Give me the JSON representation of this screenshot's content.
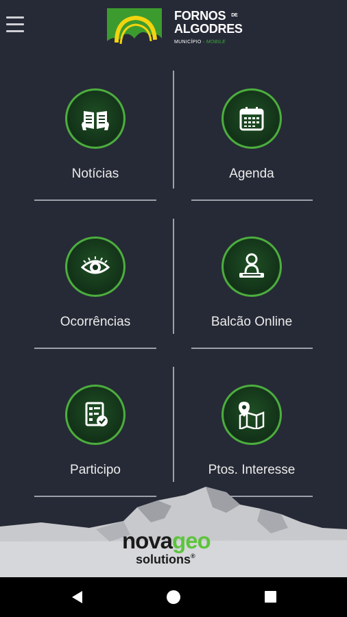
{
  "header": {
    "menu_icon": "hamburger-menu-icon",
    "logo": {
      "line1": "FORNOS",
      "de": "DE",
      "line2": "ALGODRES",
      "sub_municipio": "MUNICÍPIO · ",
      "sub_mobile": "MOBILE"
    }
  },
  "tiles": [
    {
      "label": "Notícias",
      "icon": "newspaper-icon"
    },
    {
      "label": "Agenda",
      "icon": "calendar-icon"
    },
    {
      "label": "Ocorrências",
      "icon": "eye-icon"
    },
    {
      "label": "Balcão Online",
      "icon": "service-desk-icon"
    },
    {
      "label": "Participo",
      "icon": "checklist-icon"
    },
    {
      "label": "Ptos. Interesse",
      "icon": "map-pin-icon"
    }
  ],
  "footer": {
    "brand_nova": "nova",
    "brand_geo": "geo",
    "brand_solutions": "solutions",
    "registered": "®"
  },
  "colors": {
    "background": "#262a36",
    "accent_green": "#4cae3e",
    "circle_dark_green": "#14351a",
    "divider": "#9da1a9"
  },
  "navbar": {
    "back_icon": "back-triangle-icon",
    "home_icon": "home-circle-icon",
    "recent_icon": "recent-apps-square-icon"
  }
}
